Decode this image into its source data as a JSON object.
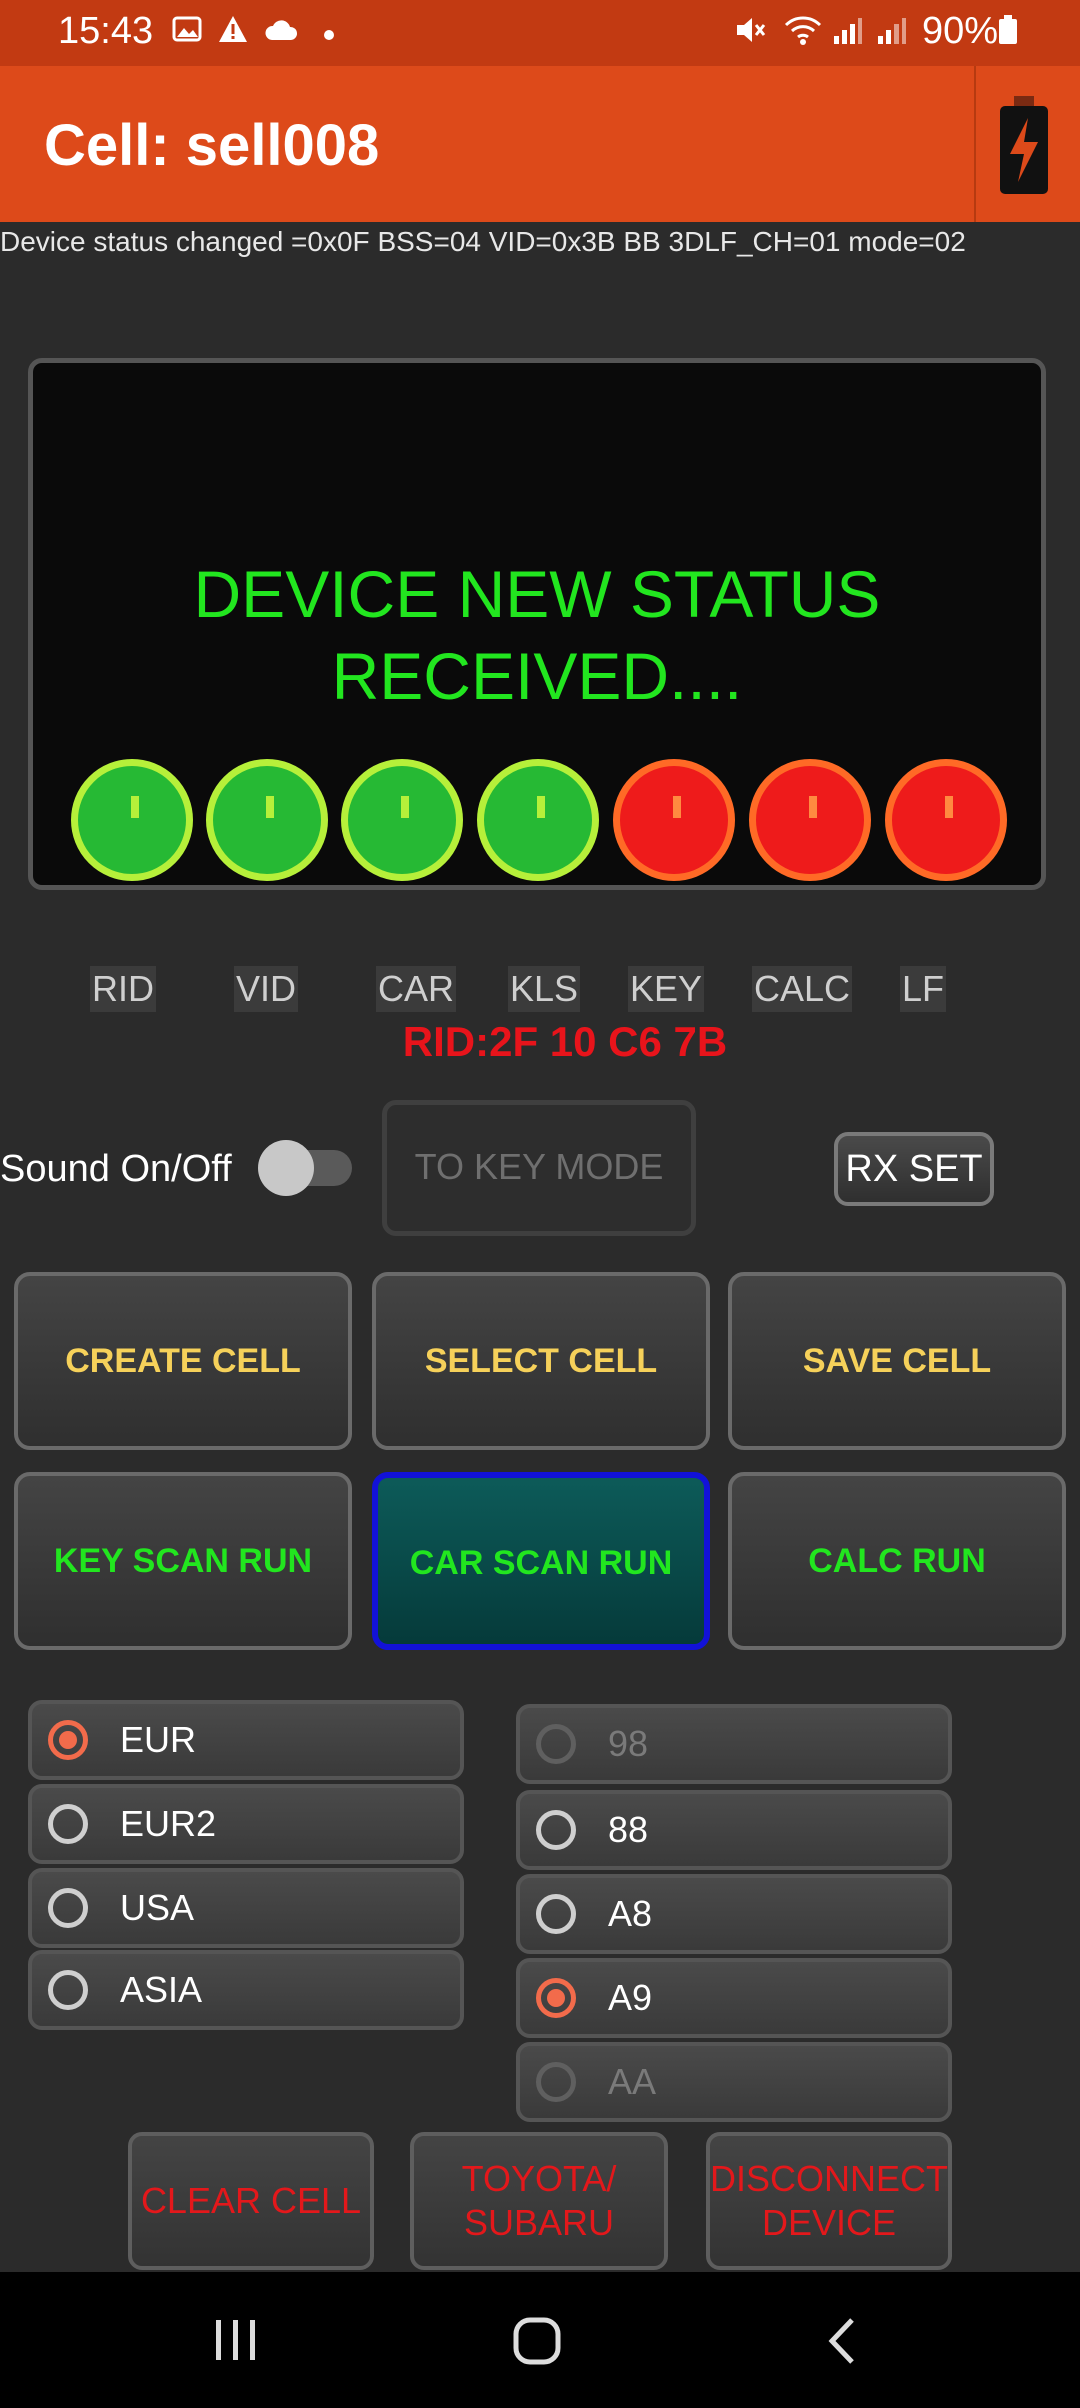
{
  "status_bar": {
    "time": "15:43",
    "battery_percent": "90%",
    "icons": [
      "image-icon",
      "warning-icon",
      "cloud-icon",
      "dot-icon",
      "mute-icon",
      "wifi-icon",
      "signal-icon",
      "signal-icon",
      "battery-icon"
    ]
  },
  "app_bar": {
    "title": "Cell: sell008",
    "action_icon": "battery-charging-icon"
  },
  "status_message": "Device status changed =0x0F BSS=04 VID=0x3B BB 3DLF_CH=01 mode=02",
  "display": {
    "line1": "DEVICE NEW STATUS",
    "line2": "RECEIVED....",
    "indicators": [
      "green",
      "green",
      "green",
      "green",
      "red",
      "red",
      "red"
    ],
    "colors": {
      "green": "#26b934",
      "red": "#ee1b1b",
      "text": "#22e61f"
    }
  },
  "labels": [
    "RID",
    "VID",
    "CAR",
    "KLS",
    "KEY",
    "CALC",
    "LF"
  ],
  "rid_value": "RID:2F 10 C6 7B",
  "sound": {
    "label": "Sound  On/Off",
    "on": false
  },
  "buttons": {
    "to_key_mode": "TO KEY MODE",
    "rx_set": "RX SET",
    "create_cell": "CREATE CELL",
    "select_cell": "SELECT CELL",
    "save_cell": "SAVE CELL",
    "key_scan_run": "KEY SCAN RUN",
    "car_scan_run": "CAR SCAN RUN",
    "calc_run": "CALC RUN",
    "clear_cell": "CLEAR CELL",
    "toyota_line1": "TOYOTA/",
    "toyota_line2": "SUBARU",
    "disconnect_line1": "DISCONNECT",
    "disconnect_line2": "DEVICE"
  },
  "regions": [
    {
      "label": "EUR",
      "selected": true
    },
    {
      "label": "EUR2",
      "selected": false
    },
    {
      "label": "USA",
      "selected": false
    },
    {
      "label": "ASIA",
      "selected": false
    }
  ],
  "codes": [
    {
      "label": "98",
      "selected": false,
      "enabled": false
    },
    {
      "label": "88",
      "selected": false,
      "enabled": true
    },
    {
      "label": "A8",
      "selected": false,
      "enabled": true
    },
    {
      "label": "A9",
      "selected": true,
      "enabled": true
    },
    {
      "label": "AA",
      "selected": false,
      "enabled": false
    }
  ],
  "accent_color": "#dd4a1a"
}
